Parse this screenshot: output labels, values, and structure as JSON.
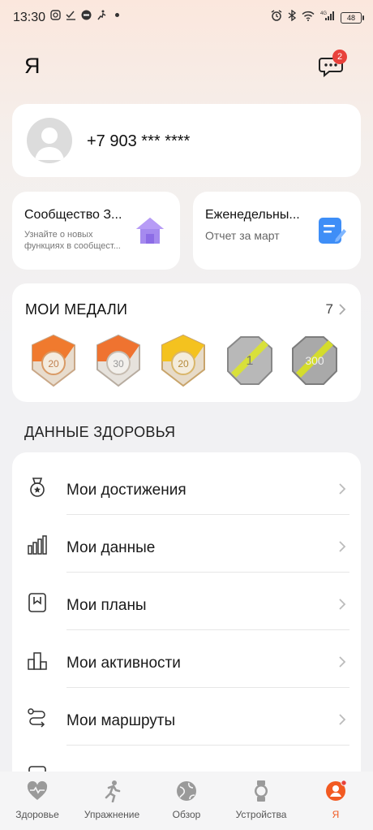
{
  "status_bar": {
    "time": "13:30",
    "battery": "48",
    "network": "4G"
  },
  "header": {
    "title": "Я",
    "messages_badge": "2"
  },
  "profile": {
    "phone": "+7 903 *** ****"
  },
  "community": {
    "title": "Сообщество З...",
    "subtitle_line1": "Узнайте о новых",
    "subtitle_line2": "функциях в сообщест..."
  },
  "weekly": {
    "title": "Еженедельны...",
    "subtitle": "Отчет за март"
  },
  "medals": {
    "title": "МОИ МЕДАЛИ",
    "count": "7",
    "items": [
      {
        "label": "20"
      },
      {
        "label": "30"
      },
      {
        "label": "20"
      },
      {
        "label": "1"
      },
      {
        "label": "300"
      }
    ]
  },
  "health": {
    "title": "ДАННЫЕ ЗДОРОВЬЯ",
    "items": [
      {
        "label": "Мои достижения",
        "icon": "medal-icon"
      },
      {
        "label": "Мои данные",
        "icon": "bar-chart-icon"
      },
      {
        "label": "Мои планы",
        "icon": "bookmark-plan-icon"
      },
      {
        "label": "Мои активности",
        "icon": "activities-icon"
      },
      {
        "label": "Мои маршруты",
        "icon": "route-icon"
      }
    ]
  },
  "tabs": [
    {
      "label": "Здоровье",
      "icon": "heart-icon"
    },
    {
      "label": "Упражнение",
      "icon": "runner-icon"
    },
    {
      "label": "Обзор",
      "icon": "globe-icon"
    },
    {
      "label": "Устройства",
      "icon": "watch-icon"
    },
    {
      "label": "Я",
      "icon": "profile-icon"
    }
  ],
  "colors": {
    "accent": "#f25a22",
    "badge": "#e8413b"
  }
}
